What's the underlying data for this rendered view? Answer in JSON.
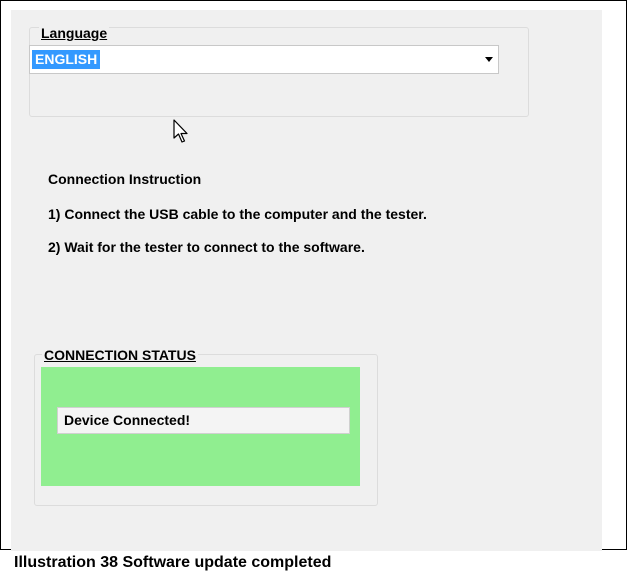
{
  "language": {
    "group_label": "Language",
    "selected_value": "ENGLISH"
  },
  "instructions": {
    "heading": "Connection Instruction",
    "step1": "1) Connect the USB cable to the computer and the tester.",
    "step2": "2) Wait for the tester to connect to the software."
  },
  "status": {
    "group_label": "CONNECTION STATUS",
    "message": "Device Connected!",
    "box_color": "#90ee90"
  },
  "caption": "Illustration 38 Software update completed",
  "icons": {
    "dropdown": "chevron-down-icon",
    "cursor": "mouse-pointer-icon"
  }
}
